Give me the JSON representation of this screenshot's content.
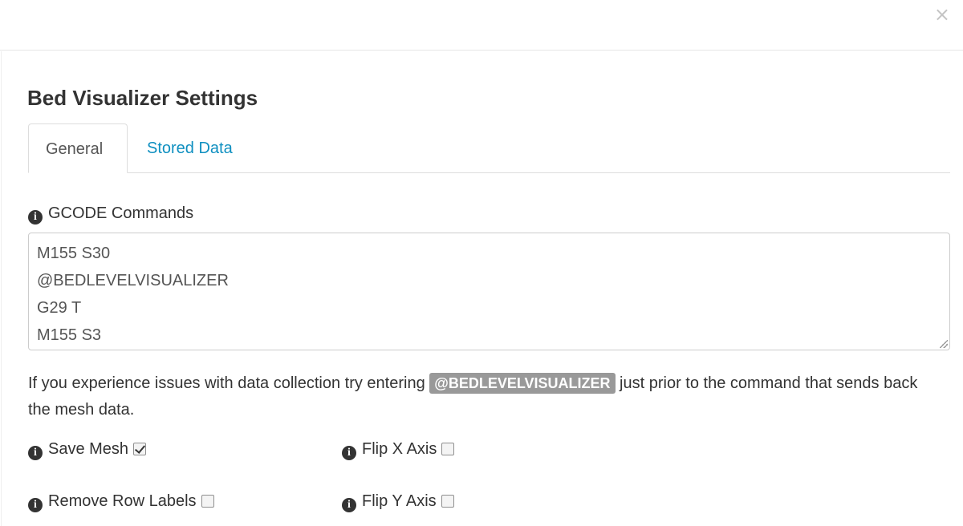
{
  "header": {
    "close_label": "×"
  },
  "settings": {
    "title": "Bed Visualizer Settings",
    "tabs": [
      {
        "label": "General",
        "active": true
      },
      {
        "label": "Stored Data",
        "active": false
      }
    ],
    "gcode_label": "GCODE Commands",
    "gcode_lines": [
      "M155 S30",
      "@BEDLEVELVISUALIZER",
      "G29 T",
      "M155 S3"
    ],
    "help_text_before": "If you experience issues with data collection try entering ",
    "help_code": "@BEDLEVELVISUALIZER",
    "help_text_after": " just prior to the command that sends back the mesh data.",
    "options": {
      "save_mesh": {
        "label": "Save Mesh",
        "checked": true
      },
      "flip_x": {
        "label": "Flip X Axis",
        "checked": false
      },
      "remove_row_labels": {
        "label": "Remove Row Labels",
        "checked": false
      },
      "flip_y": {
        "label": "Flip Y Axis",
        "checked": false
      }
    }
  },
  "icons": {
    "info": "info-circle-icon",
    "close": "close-icon"
  },
  "colors": {
    "link": "#0e8fc0",
    "badge": "#999999"
  }
}
